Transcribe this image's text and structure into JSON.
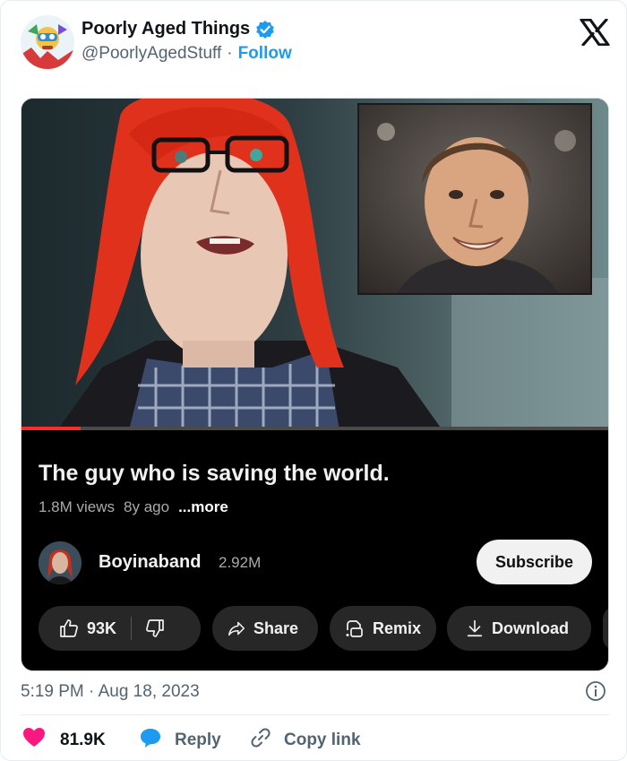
{
  "tweet": {
    "author_name": "Poorly Aged Things",
    "handle": "@PoorlyAgedStuff",
    "separator": "·",
    "follow_label": "Follow",
    "timestamp": "5:19 PM · Aug 18, 2023",
    "likes": "81.9K",
    "reply_label": "Reply",
    "copy_link_label": "Copy link",
    "colors": {
      "accent": "#1d9bf0",
      "like": "#f91880",
      "muted": "#536471"
    }
  },
  "video": {
    "title": "The guy who is saving the world.",
    "views": "1.8M views",
    "age": "8y ago",
    "more_label": "...more",
    "progress": 0.1,
    "channel_name": "Boyinaband",
    "subscriber_count": "2.92M",
    "subscribe_label": "Subscribe",
    "like_count": "93K",
    "share_label": "Share",
    "remix_label": "Remix",
    "download_label": "Download"
  },
  "icons": [
    "verified-badge-icon",
    "x-logo-icon",
    "thumbs-up-icon",
    "thumbs-down-icon",
    "share-arrow-icon",
    "remix-icon",
    "download-icon",
    "info-icon",
    "heart-icon",
    "reply-bubble-icon",
    "link-icon"
  ]
}
